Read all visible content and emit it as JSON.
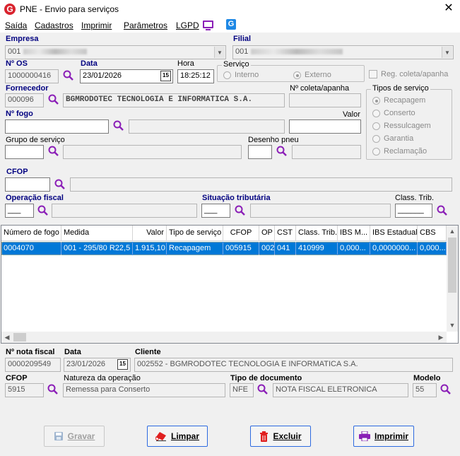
{
  "window": {
    "title": "PNE - Envio para serviços"
  },
  "menu": {
    "items": [
      "Saída",
      "Cadastros",
      "Imprimir",
      "Parâmetros",
      "LGPD"
    ]
  },
  "form": {
    "empresa_label": "Empresa",
    "empresa_value": "001",
    "filial_label": "Filial",
    "filial_value": "001",
    "os_label": "Nº OS",
    "os_value": "1000000416",
    "data_label": "Data",
    "data_value": "23/01/2026",
    "hora_label": "Hora",
    "hora_value": "18:25:12",
    "servico_group": "Serviço",
    "servico_options": [
      "Interno",
      "Externo"
    ],
    "reg_coleta_label": "Reg. coleta/apanha",
    "fornecedor_label": "Fornecedor",
    "fornecedor_code": "000096",
    "fornecedor_name": "BGMRODOTEC TECNOLOGIA E INFORMATICA S.A.",
    "coleta_label": "Nº coleta/apanha",
    "tipos_group": "Tipos de serviço",
    "tipos_options": [
      "Recapagem",
      "Conserto",
      "Ressulcagem",
      "Garantia",
      "Reclamação"
    ],
    "fogo_label": "Nº  fogo",
    "valor_label": "Valor",
    "grupo_label": "Grupo de serviço",
    "desenho_label": "Desenho pneu",
    "cfop_label": "CFOP",
    "operacao_label": "Operação fiscal",
    "situacao_label": "Situação tributária",
    "class_trib_label": "Class. Trib."
  },
  "grid": {
    "columns": [
      "Número de fogo",
      "Medida",
      "Valor",
      "Tipo de serviço",
      "CFOP",
      "OP",
      "CST",
      "Class. Trib.",
      "IBS M...",
      "IBS Estadual",
      "CBS"
    ],
    "rows": [
      [
        "0004070",
        "001 - 295/80 R22,5",
        "1.915,10",
        "Recapagem",
        "005915",
        "002",
        "041",
        "410999",
        "0,000...",
        "0,0000000...",
        "0,000..."
      ]
    ]
  },
  "nota": {
    "nota_label": "Nº nota fiscal",
    "nota_value": "0000209549",
    "data_label": "Data",
    "data_value": "23/01/2026",
    "cliente_label": "Cliente",
    "cliente_value": "002552 - BGMRODOTEC TECNOLOGIA E INFORMATICA S.A.",
    "cfop_label": "CFOP",
    "cfop_value": "5915",
    "natureza_label": "Natureza da operação",
    "natureza_value": "Remessa para Conserto",
    "tipo_doc_label": "Tipo de documento",
    "tipo_doc_code": "NFE",
    "tipo_doc_name": "NOTA FISCAL ELETRONICA",
    "modelo_label": "Modelo",
    "modelo_value": "55"
  },
  "buttons": {
    "gravar": "Gravar",
    "limpar": "Limpar",
    "excluir": "Excluir",
    "imprimir": "Imprimir"
  },
  "colors": {
    "accent": "#0078d7",
    "label": "#000080",
    "selection": "#0078d7"
  }
}
